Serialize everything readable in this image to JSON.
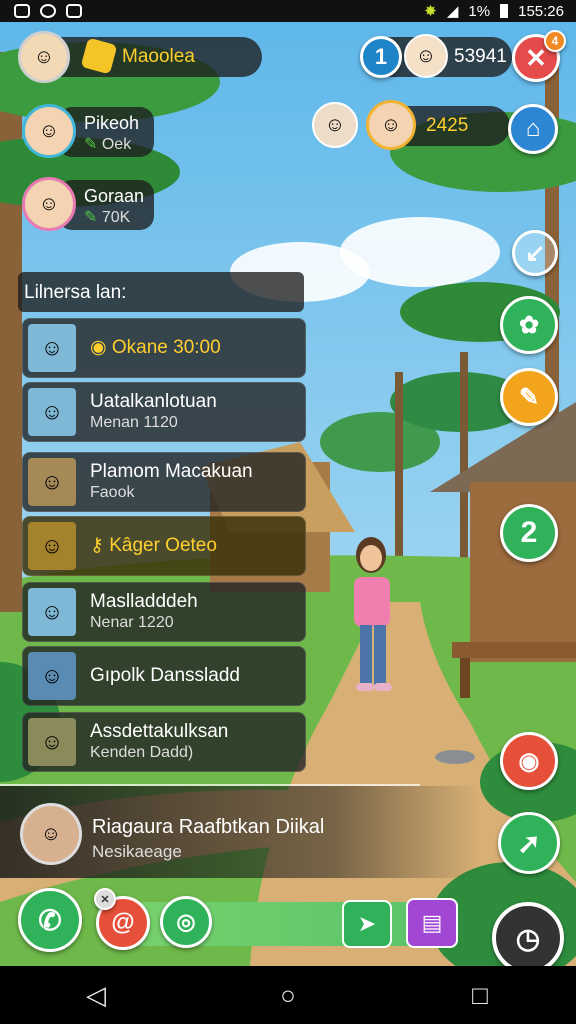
{
  "statusbar": {
    "time": "155:26",
    "battery": "1%"
  },
  "top": {
    "player_name": "Maoolea",
    "level_badge": "1",
    "coins": "53941",
    "close_badge": "4"
  },
  "friends": [
    {
      "name": "Pikeoh",
      "sub": "Oek"
    },
    {
      "name": "Goraan",
      "sub": "70K"
    }
  ],
  "score_right": "2425",
  "list_header": "Lilnersa lan:",
  "rows": [
    {
      "title": "Okane 30:00",
      "sub": ""
    },
    {
      "title": "Uatalkanlotuan",
      "sub": "Menan 1120"
    },
    {
      "title": "Plamom Macakuan",
      "sub": "Faook"
    },
    {
      "title": "Kâger Oeteo",
      "sub": ""
    },
    {
      "title": "Maslladddeh",
      "sub": "Nenar 1220"
    },
    {
      "title": "Gıpolk Danssladd",
      "sub": ""
    },
    {
      "title": "Assdettakulksan",
      "sub": "Kenden Dadd)"
    }
  ],
  "right_badge_number": "2",
  "player_bar": {
    "name": "Riagaura Raafbtkan Diikal",
    "status": "Nesikaeage"
  },
  "nav": [
    "back",
    "home",
    "recents"
  ]
}
